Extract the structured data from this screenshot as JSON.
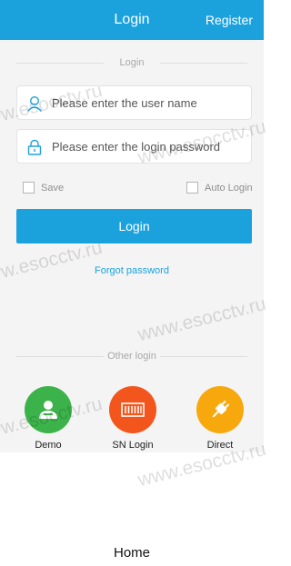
{
  "header": {
    "title": "Login",
    "register_label": "Register"
  },
  "login_divider": "Login",
  "username": {
    "placeholder": "Please enter the user name",
    "value": ""
  },
  "password": {
    "placeholder": "Please enter the login password",
    "value": ""
  },
  "options": {
    "save_label": "Save",
    "auto_login_label": "Auto Login",
    "save_checked": false,
    "auto_login_checked": false
  },
  "login_button": "Login",
  "forgot_link": "Forgot password",
  "other_login": {
    "label": "Other login",
    "items": [
      {
        "label": "Demo",
        "icon": "user-icon",
        "color": "#3cb34a"
      },
      {
        "label": "SN Login",
        "icon": "barcode-icon",
        "color": "#f2561d"
      },
      {
        "label": "Direct",
        "icon": "plug-icon",
        "color": "#f7a80d"
      }
    ]
  },
  "bottom_nav": {
    "home_label": "Home"
  },
  "watermark": "www.esocctv.ru",
  "colors": {
    "primary": "#1ba2dd",
    "background": "#f4f4f4"
  }
}
